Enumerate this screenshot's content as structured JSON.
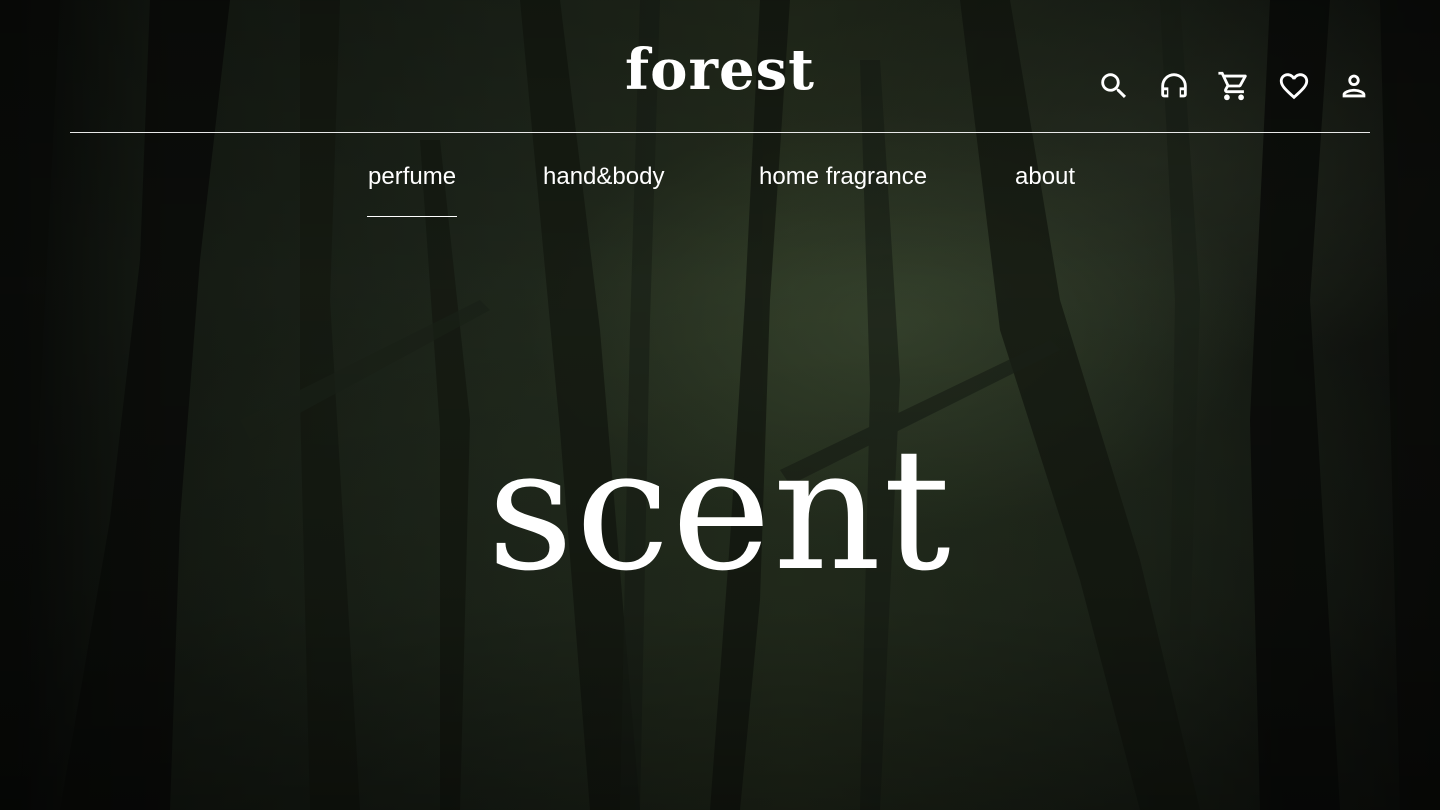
{
  "brand": {
    "logo_text": "forest"
  },
  "header_icons": [
    {
      "name": "search-icon"
    },
    {
      "name": "headset-icon"
    },
    {
      "name": "cart-icon"
    },
    {
      "name": "heart-icon"
    },
    {
      "name": "user-icon"
    }
  ],
  "nav": {
    "items": [
      {
        "label": "perfume",
        "active": true
      },
      {
        "label": "hand&body",
        "active": false
      },
      {
        "label": "home fragrance",
        "active": false
      },
      {
        "label": "about",
        "active": false
      }
    ]
  },
  "hero": {
    "title": "scent"
  },
  "colors": {
    "text": "#ffffff",
    "background_dark": "#141a12",
    "rule": "#e8e8e8"
  }
}
